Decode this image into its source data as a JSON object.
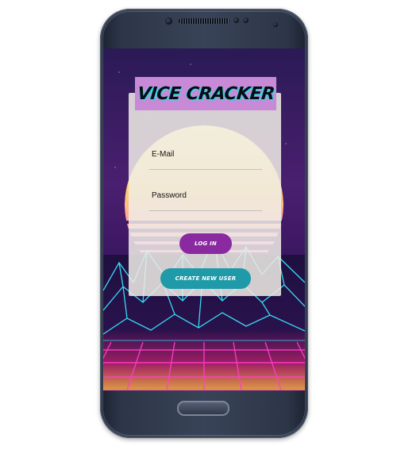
{
  "app": {
    "title": "VICE CRACKER"
  },
  "login_form": {
    "email_label": "E-Mail",
    "email_value": "",
    "password_label": "Password",
    "password_value": ""
  },
  "buttons": {
    "login_label": "LOG IN",
    "create_user_label": "CREATE NEW USER"
  },
  "colors": {
    "title_bar": "#c88ad6",
    "title_glow": "#2ed8e6",
    "login_button": "#8a2aa0",
    "create_button": "#1f9aa8",
    "phone_body": "#394357"
  },
  "icons": {
    "home": "home-button-icon",
    "camera": "front-camera-icon",
    "speaker": "earpiece-speaker-icon"
  }
}
